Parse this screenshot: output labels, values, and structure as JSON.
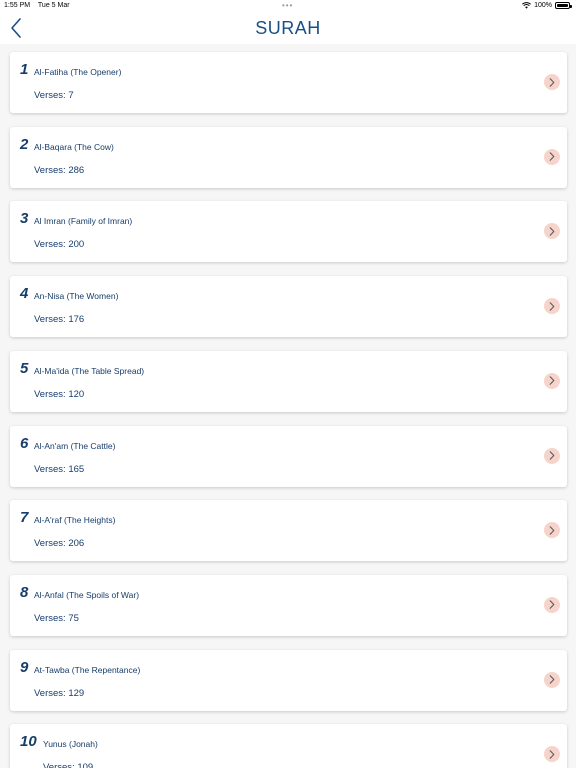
{
  "status": {
    "time": "1:55 PM",
    "date": "Tue 5 Mar",
    "dots": "•••",
    "battery": "100%"
  },
  "nav": {
    "title": "SURAH"
  },
  "surahs": [
    {
      "number": "1",
      "name": "Al-Fatiha (The Opener)",
      "verses": "Verses: 7"
    },
    {
      "number": "2",
      "name": "Al-Baqara (The Cow)",
      "verses": "Verses: 286"
    },
    {
      "number": "3",
      "name": "Al Imran (Family of Imran)",
      "verses": "Verses: 200"
    },
    {
      "number": "4",
      "name": "An-Nisa (The Women)",
      "verses": "Verses: 176"
    },
    {
      "number": "5",
      "name": "Al-Ma'ida (The Table Spread)",
      "verses": "Verses: 120"
    },
    {
      "number": "6",
      "name": "Al-An'am (The Cattle)",
      "verses": "Verses: 165"
    },
    {
      "number": "7",
      "name": "Al-A'raf (The Heights)",
      "verses": "Verses: 206"
    },
    {
      "number": "8",
      "name": "Al-Anfal (The Spoils of War)",
      "verses": "Verses: 75"
    },
    {
      "number": "9",
      "name": "At-Tawba (The Repentance)",
      "verses": "Verses: 129"
    },
    {
      "number": "10",
      "name": "Yunus (Jonah)",
      "verses": "Verses: 109"
    }
  ],
  "icons": {
    "back": "chevron-left-icon",
    "row": "chevron-right-icon",
    "wifi": "wifi-icon",
    "battery": "battery-icon"
  },
  "colors": {
    "text": "#173d6b",
    "title": "#1a4f86",
    "chevron_bg": "#f6d4cb",
    "background": "#f6f6f6"
  }
}
